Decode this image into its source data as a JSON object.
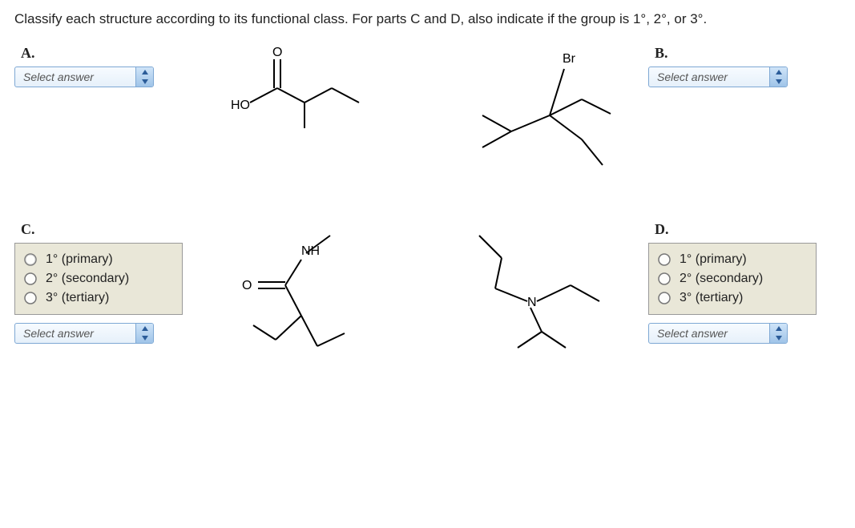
{
  "question": "Classify each structure according to its functional class. For parts C and D, also indicate if the group is 1°, 2°, or 3°.",
  "parts": {
    "A": {
      "label": "A.",
      "select": "Select answer"
    },
    "B": {
      "label": "B.",
      "select": "Select answer"
    },
    "C": {
      "label": "C.",
      "select": "Select answer",
      "options": [
        "1° (primary)",
        "2° (secondary)",
        "3° (tertiary)"
      ]
    },
    "D": {
      "label": "D.",
      "select": "Select answer",
      "options": [
        "1° (primary)",
        "2° (secondary)",
        "3° (tertiary)"
      ]
    }
  },
  "structure_labels": {
    "A_HO": "HO",
    "A_O": "O",
    "B_Br": "Br",
    "C_NH": "NH",
    "C_O": "O",
    "D_N": "N"
  }
}
